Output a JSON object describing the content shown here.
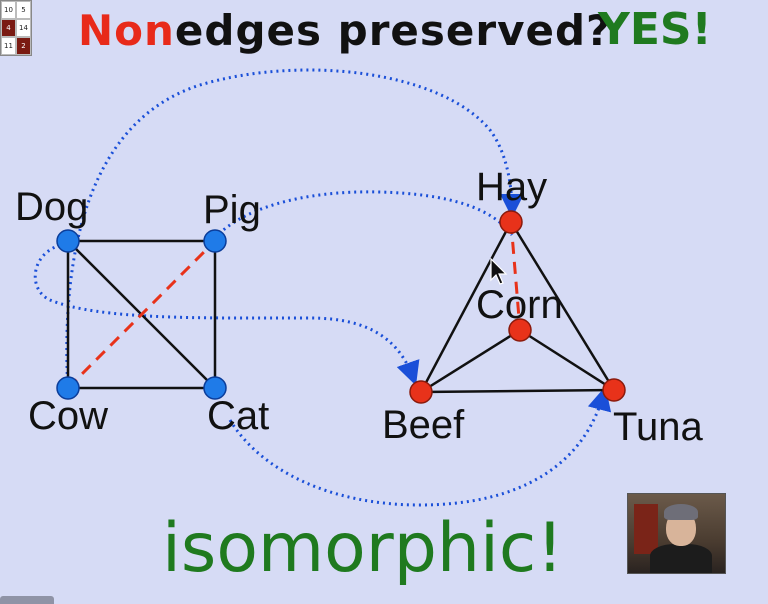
{
  "slide": {
    "title_accent": "Non",
    "title_rest": "edges preserved?",
    "answer": "YES!",
    "result": "isomorphic!"
  },
  "graph_left": {
    "nodes": [
      {
        "id": "dog",
        "label": "Dog"
      },
      {
        "id": "pig",
        "label": "Pig"
      },
      {
        "id": "cow",
        "label": "Cow"
      },
      {
        "id": "cat",
        "label": "Cat"
      }
    ],
    "edges": [
      [
        "dog",
        "pig"
      ],
      [
        "dog",
        "cow"
      ],
      [
        "dog",
        "cat"
      ],
      [
        "pig",
        "cat"
      ],
      [
        "cow",
        "cat"
      ]
    ],
    "nonedge": [
      "cow",
      "pig"
    ]
  },
  "graph_right": {
    "nodes": [
      {
        "id": "hay",
        "label": "Hay"
      },
      {
        "id": "corn",
        "label": "Corn"
      },
      {
        "id": "beef",
        "label": "Beef"
      },
      {
        "id": "tuna",
        "label": "Tuna"
      }
    ],
    "edges": [
      [
        "hay",
        "beef"
      ],
      [
        "hay",
        "tuna"
      ],
      [
        "beef",
        "tuna"
      ],
      [
        "corn",
        "beef"
      ],
      [
        "corn",
        "tuna"
      ]
    ],
    "nonedge": [
      "hay",
      "corn"
    ]
  },
  "mapping": [
    [
      "dog",
      "hay"
    ],
    [
      "pig",
      "beef"
    ],
    [
      "cow",
      "corn"
    ],
    [
      "cat",
      "tuna"
    ]
  ],
  "grid_widget": {
    "cells": [
      "10",
      "5",
      "4",
      "14",
      "11",
      "2"
    ]
  },
  "colors": {
    "background": "#d6dbf5",
    "left_node": "#1f7be8",
    "right_node": "#e8321a",
    "nonedge": "#e8321a",
    "mapping_arrow": "#1a4fd8",
    "answer": "#1f7a1f"
  },
  "icons": {
    "cursor": "arrow-cursor-icon",
    "webcam": "webcam-presenter-icon"
  }
}
